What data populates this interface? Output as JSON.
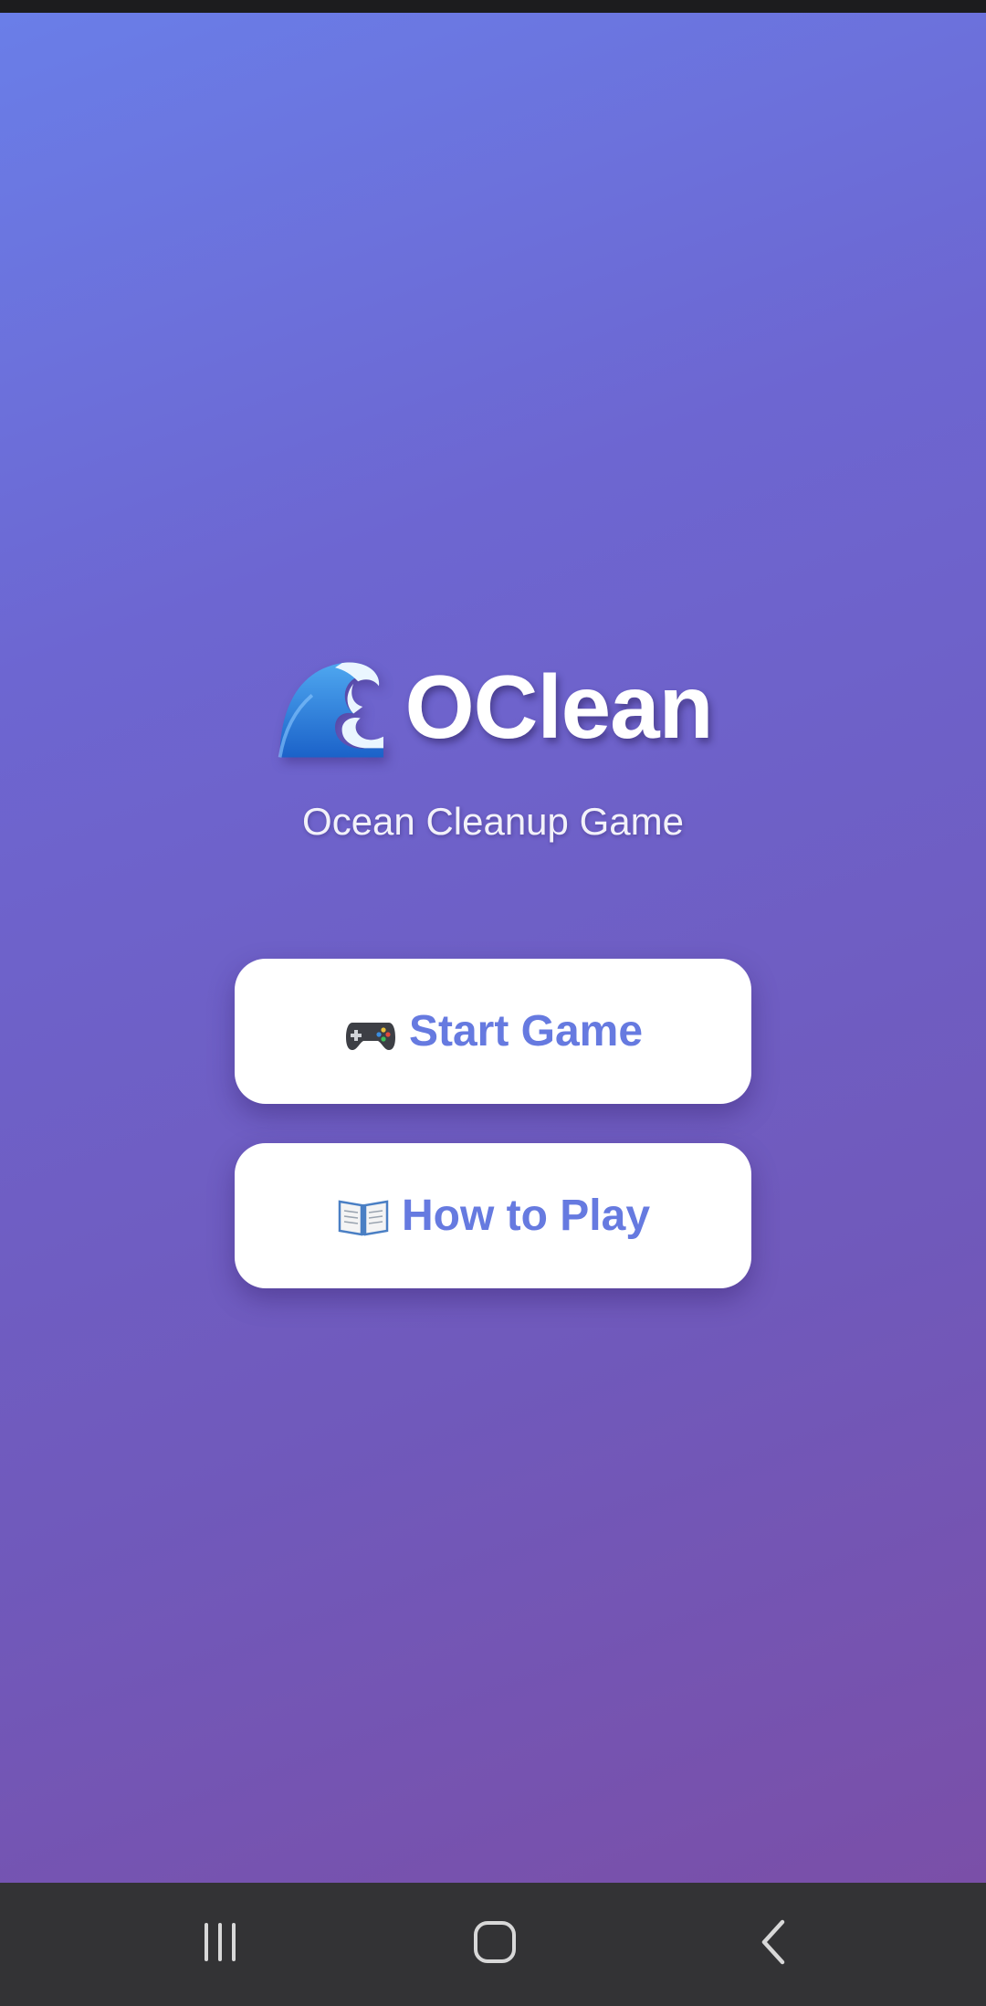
{
  "app": {
    "title": "OClean",
    "subtitle": "Ocean Cleanup Game",
    "title_icon": "wave-icon"
  },
  "menu": {
    "start_label": "Start Game",
    "start_icon": "game-controller-icon",
    "howto_label": "How to Play",
    "howto_icon": "open-book-icon"
  },
  "navigation_bar": {
    "buttons": [
      "recents-icon",
      "home-icon",
      "back-icon"
    ]
  },
  "colors": {
    "gradient_start": "#6a7ee8",
    "gradient_end": "#7a4fa8",
    "button_text": "#667ae0",
    "button_bg": "#ffffff",
    "nav_bg": "#333335"
  }
}
